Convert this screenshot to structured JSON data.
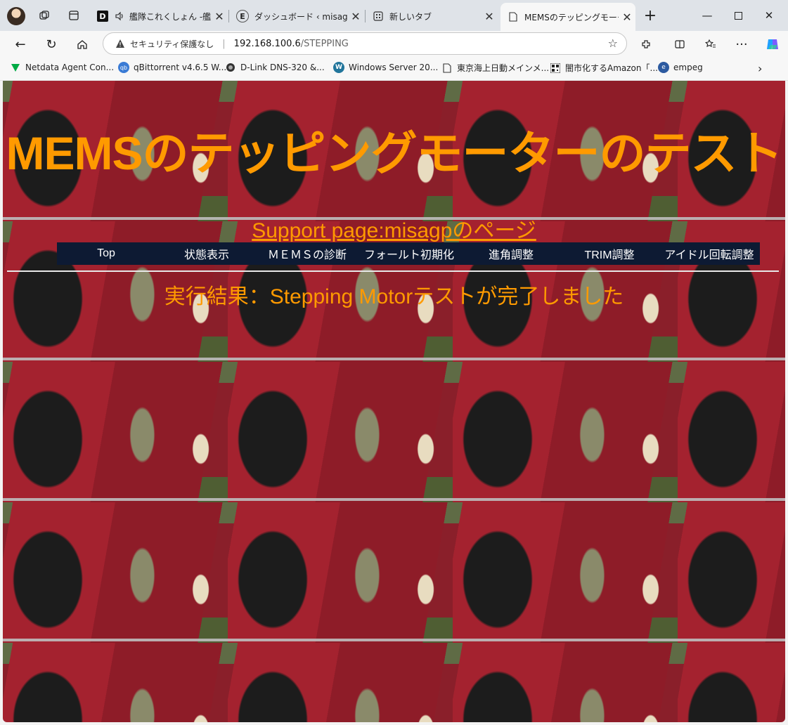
{
  "tabs": [
    {
      "title": "艦隊これくしょん -艦こ",
      "favicon": "D"
    },
    {
      "title": "ダッシュボード ‹ misagoのペ",
      "favicon": "E"
    },
    {
      "title": "新しいタブ",
      "favicon": "newtab-icon"
    },
    {
      "title": "MEMSのテッピングモーターの",
      "favicon": "page-icon",
      "active": true
    }
  ],
  "address_bar": {
    "security_label": "セキュリティ保護なし",
    "host": "192.168.100.6",
    "path": "/STEPPING"
  },
  "bookmarks": [
    {
      "label": "Netdata Agent Con...",
      "icon": "netdata-icon"
    },
    {
      "label": "qBittorrent v4.6.5 W...",
      "icon": "qb-icon"
    },
    {
      "label": "D-Link DNS-320 &...",
      "icon": "dlink-icon"
    },
    {
      "label": "Windows Server 20...",
      "icon": "wordpress-icon"
    },
    {
      "label": "東京海上日動メインメ...",
      "icon": "page-icon"
    },
    {
      "label": "闇市化するAmazon「...",
      "icon": "qr-icon"
    },
    {
      "label": "empeg",
      "icon": "empeg-icon"
    }
  ],
  "page": {
    "title": "MEMSのテッピングモーターのテスト",
    "support_link": "Support page:misagpのページ",
    "nav": [
      "Top",
      "状態表示",
      "ＭＥＭＳの診断",
      "フォールト初期化",
      "進角調整",
      "TRIM調整",
      "アイドル回転調整"
    ],
    "result": "実行結果：Stepping Motorテストが完了しました"
  },
  "colors": {
    "accent": "#ff9a00",
    "navbar": "#0d1a33"
  }
}
